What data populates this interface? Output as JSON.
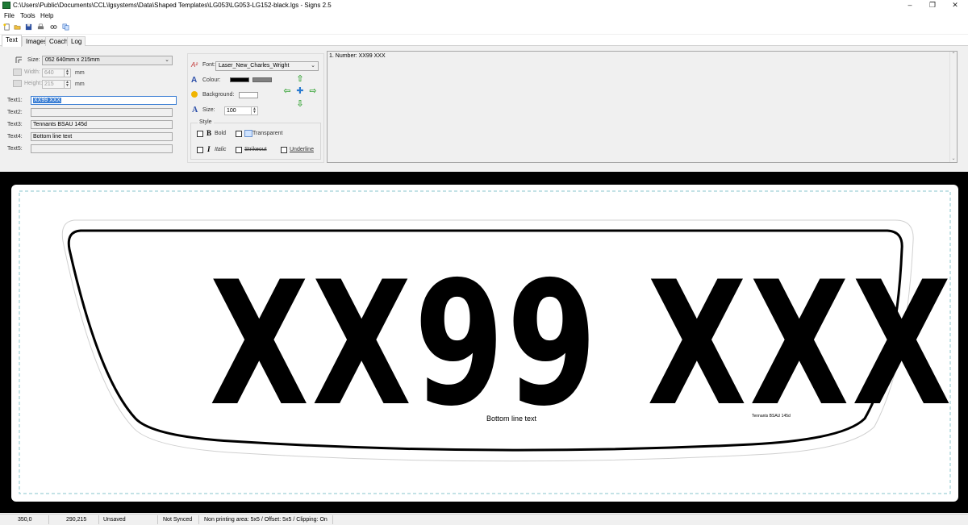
{
  "window": {
    "title": "C:\\Users\\Public\\Documents\\CCL\\lgsystems\\Data\\Shaped Templates\\LG053\\LG053-LG152-black.lgs - Signs 2.5",
    "minimize": "–",
    "restore": "❐",
    "close": "✕"
  },
  "menu": {
    "file": "File",
    "tools": "Tools",
    "help": "Help"
  },
  "tabs": [
    {
      "label": "Text"
    },
    {
      "label": "Images"
    },
    {
      "label": "Coach"
    },
    {
      "label": "Log"
    }
  ],
  "size_panel": {
    "size_label": "Size:",
    "size_value": "052 640mm x 215mm",
    "width_label": "Width:",
    "width_value": "640",
    "height_label": "Height:",
    "height_value": "215",
    "unit": "mm"
  },
  "text_fields": [
    {
      "label": "Text1:",
      "value": "XX99 XXX"
    },
    {
      "label": "Text2:",
      "value": ""
    },
    {
      "label": "Text3:",
      "value": "Tennants BSAU 145d"
    },
    {
      "label": "Text4:",
      "value": "Bottom line text"
    },
    {
      "label": "Text5:",
      "value": ""
    }
  ],
  "font_panel": {
    "font_label": "Font:",
    "font_value": "Laser_New_Charles_Wright",
    "colour_label": "Colour:",
    "background_label": "Background:",
    "size_label": "Size:",
    "size_value": "100",
    "style_label": "Style",
    "bold_label": "Bold",
    "transparent_label": "Transparent",
    "italic_label": "Italic",
    "strikeout_label": "Strikeout",
    "underline_label": "Underline",
    "bold_glyph": "B",
    "italic_glyph": "I",
    "size_glyph": "A",
    "colour_glyph": "A",
    "font_glyph": "A²"
  },
  "colors": {
    "text_colour": "#000000",
    "text_colour_alt": "#808080",
    "background": "#ffffff",
    "arrow": "#3aa53a",
    "plate_guide": "#9fd0d6"
  },
  "list_panel": {
    "items": [
      "1. Number: XX99 XXX"
    ]
  },
  "plate": {
    "registration": "XX99 XXX",
    "bottom_text": "Bottom line text",
    "dealer_text": "Tennants BSAU 145d"
  },
  "status": {
    "coord1": "350,0",
    "coord2": "290,215",
    "saved": "Unsaved",
    "sync": "Not Synced",
    "info": "Non printing area: 5x5 / Offset: 5x5 / Clipping: On"
  }
}
